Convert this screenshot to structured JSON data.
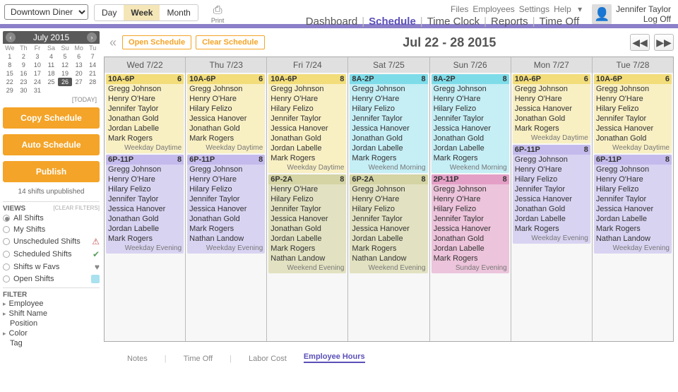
{
  "top": {
    "location": "Downtown Diner",
    "tabs": {
      "day": "Day",
      "week": "Week",
      "month": "Month"
    },
    "print": "Print",
    "links1": [
      "Files",
      "Employees",
      "Settings",
      "Help"
    ],
    "links2": [
      "Dashboard",
      "Schedule",
      "Time Clock",
      "Reports",
      "Time Off"
    ],
    "user": "Jennifer Taylor",
    "logoff": "Log Off"
  },
  "cal": {
    "title": "July 2015",
    "dow": [
      "We",
      "Th",
      "Fr",
      "Sa",
      "Su",
      "Mo",
      "Tu"
    ],
    "today": "[TODAY]"
  },
  "actions": {
    "copy": "Copy Schedule",
    "auto": "Auto Schedule",
    "publish": "Publish",
    "unpub": "14 shifts unpublished"
  },
  "views": {
    "hdr": "VIEWS",
    "clear": "[CLEAR FILTERS]",
    "items": [
      {
        "label": "All Shifts",
        "on": true
      },
      {
        "label": "My Shifts"
      },
      {
        "label": "Unscheduled Shifts",
        "chip": "⚠",
        "chipClass": "chip-warn"
      },
      {
        "label": "Scheduled Shifts",
        "chip": "✔",
        "chipClass": "chip-check"
      },
      {
        "label": "Shifts w Favs",
        "chip": "♥",
        "chipClass": "chip-heart"
      },
      {
        "label": "Open Shifts",
        "chip": "box"
      }
    ]
  },
  "filter": {
    "hdr": "FILTER",
    "items": [
      "Employee",
      "Shift Name",
      "Position",
      "Color",
      "Tag"
    ]
  },
  "sched": {
    "open": "Open Schedule",
    "clear": "Clear Schedule",
    "range": "Jul 22 - 28 2015",
    "days": [
      "Wed 7/22",
      "Thu 7/23",
      "Fri 7/24",
      "Sat 7/25",
      "Sun 7/26",
      "Mon 7/27",
      "Tue 7/28"
    ],
    "cols": [
      [
        {
          "time": "10A-6P",
          "count": "6",
          "color": "yellow",
          "foot": "Weekday Daytime",
          "names": [
            "Gregg Johnson",
            "Henry O'Hare",
            "Jennifer Taylor",
            "Jonathan Gold",
            "Jordan Labelle",
            "Mark Rogers"
          ]
        },
        {
          "time": "6P-11P",
          "count": "8",
          "color": "purple",
          "foot": "Weekday Evening",
          "names": [
            "Gregg Johnson",
            "Henry O'Hare",
            "Hilary Felizo",
            "Jennifer Taylor",
            "Jessica Hanover",
            "Jonathan Gold",
            "Jordan Labelle",
            "Mark Rogers"
          ]
        }
      ],
      [
        {
          "time": "10A-6P",
          "count": "6",
          "color": "yellow",
          "foot": "Weekday Daytime",
          "names": [
            "Gregg Johnson",
            "Henry O'Hare",
            "Hilary Felizo",
            "Jessica Hanover",
            "Jonathan Gold",
            "Mark Rogers"
          ]
        },
        {
          "time": "6P-11P",
          "count": "8",
          "color": "purple",
          "foot": "Weekday Evening",
          "names": [
            "Gregg Johnson",
            "Henry O'Hare",
            "Hilary Felizo",
            "Jennifer Taylor",
            "Jessica Hanover",
            "Jonathan Gold",
            "Mark Rogers",
            "Nathan Landow"
          ]
        }
      ],
      [
        {
          "time": "10A-6P",
          "count": "8",
          "color": "yellow",
          "foot": "Weekday Daytime",
          "names": [
            "Gregg Johnson",
            "Henry O'Hare",
            "Hilary Felizo",
            "Jennifer Taylor",
            "Jessica Hanover",
            "Jonathan Gold",
            "Jordan Labelle",
            "Mark Rogers"
          ]
        },
        {
          "time": "6P-2A",
          "count": "8",
          "color": "olive",
          "foot": "Weekend Evening",
          "names": [
            "Henry O'Hare",
            "Hilary Felizo",
            "Jennifer Taylor",
            "Jessica Hanover",
            "Jonathan Gold",
            "Jordan Labelle",
            "Mark Rogers",
            "Nathan Landow"
          ]
        }
      ],
      [
        {
          "time": "8A-2P",
          "count": "8",
          "color": "cyan",
          "foot": "Weekend Morning",
          "names": [
            "Gregg Johnson",
            "Henry O'Hare",
            "Hilary Felizo",
            "Jennifer Taylor",
            "Jessica Hanover",
            "Jonathan Gold",
            "Jordan Labelle",
            "Mark Rogers"
          ]
        },
        {
          "time": "6P-2A",
          "count": "8",
          "color": "olive",
          "foot": "Weekend Evening",
          "names": [
            "Gregg Johnson",
            "Henry O'Hare",
            "Hilary Felizo",
            "Jennifer Taylor",
            "Jessica Hanover",
            "Jordan Labelle",
            "Mark Rogers",
            "Nathan Landow"
          ]
        }
      ],
      [
        {
          "time": "8A-2P",
          "count": "8",
          "color": "cyan",
          "foot": "Weekend Morning",
          "names": [
            "Gregg Johnson",
            "Henry O'Hare",
            "Hilary Felizo",
            "Jennifer Taylor",
            "Jessica Hanover",
            "Jonathan Gold",
            "Jordan Labelle",
            "Mark Rogers"
          ]
        },
        {
          "time": "2P-11P",
          "count": "8",
          "color": "pink",
          "foot": "Sunday Evening",
          "names": [
            "Gregg Johnson",
            "Henry O'Hare",
            "Hilary Felizo",
            "Jennifer Taylor",
            "Jessica Hanover",
            "Jonathan Gold",
            "Jordan Labelle",
            "Mark Rogers"
          ]
        }
      ],
      [
        {
          "time": "10A-6P",
          "count": "6",
          "color": "yellow",
          "foot": "Weekday Daytime",
          "names": [
            "Gregg Johnson",
            "Henry O'Hare",
            "Jessica Hanover",
            "Jonathan Gold",
            "Mark Rogers"
          ]
        },
        {
          "time": "6P-11P",
          "count": "8",
          "color": "purple",
          "foot": "Weekday Evening",
          "names": [
            "Gregg Johnson",
            "Henry O'Hare",
            "Hilary Felizo",
            "Jennifer Taylor",
            "Jessica Hanover",
            "Jonathan Gold",
            "Jordan Labelle",
            "Mark Rogers"
          ]
        }
      ],
      [
        {
          "time": "10A-6P",
          "count": "6",
          "color": "yellow",
          "foot": "Weekday Daytime",
          "names": [
            "Gregg Johnson",
            "Henry O'Hare",
            "Hilary Felizo",
            "Jennifer Taylor",
            "Jessica Hanover",
            "Jonathan Gold"
          ]
        },
        {
          "time": "6P-11P",
          "count": "8",
          "color": "purple",
          "foot": "Weekday Evening",
          "names": [
            "Gregg Johnson",
            "Henry O'Hare",
            "Hilary Felizo",
            "Jennifer Taylor",
            "Jessica Hanover",
            "Jordan Labelle",
            "Mark Rogers",
            "Nathan Landow"
          ]
        }
      ]
    ]
  },
  "bottom": {
    "tabs": [
      "Notes",
      "Time Off",
      "Labor Cost",
      "Employee Hours"
    ]
  }
}
